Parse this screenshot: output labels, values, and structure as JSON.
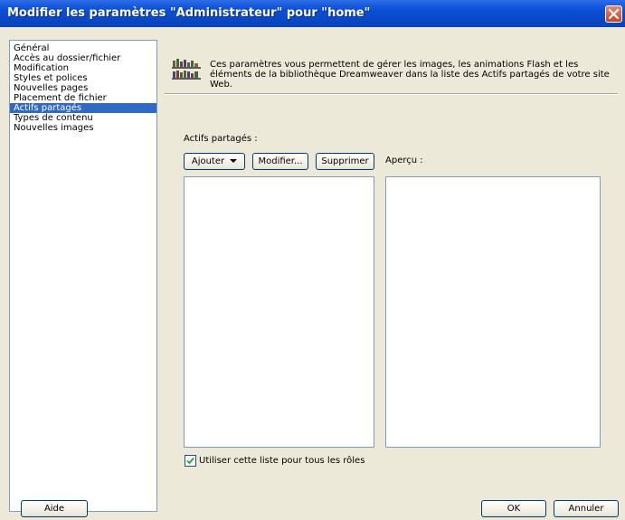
{
  "window": {
    "title": "Modifier les paramètres \"Administrateur\" pour \"home\""
  },
  "sidebar": {
    "items": [
      {
        "label": "Général",
        "selected": false
      },
      {
        "label": "Accès au dossier/fichier",
        "selected": false
      },
      {
        "label": "Modification",
        "selected": false
      },
      {
        "label": "Styles et polices",
        "selected": false
      },
      {
        "label": "Nouvelles pages",
        "selected": false
      },
      {
        "label": "Placement de fichier",
        "selected": false
      },
      {
        "label": "Actifs partagés",
        "selected": true
      },
      {
        "label": "Types de contenu",
        "selected": false
      },
      {
        "label": "Nouvelles images",
        "selected": false
      }
    ]
  },
  "main": {
    "description": "Ces paramètres vous permettent de gérer les images, les animations Flash et les éléments de la bibliothèque Dreamweaver dans la liste des Actifs partagés de votre site Web.",
    "assets_label": "Actifs partagés :",
    "preview_label": "Aperçu :",
    "add_button": "Ajouter",
    "modify_button": "Modifier...",
    "delete_button": "Supprimer",
    "use_for_all_roles": {
      "label": "Utiliser cette liste pour tous les rôles",
      "checked": true
    }
  },
  "footer": {
    "help_button": "Aide",
    "ok_button": "OK",
    "cancel_button": "Annuler"
  },
  "icons": {
    "library": "library-books-icon",
    "close": "close-icon",
    "dropdown": "caret-down-icon",
    "check": "checkmark-icon"
  },
  "colors": {
    "titlebar": "#0a50d8",
    "selection": "#316ac5",
    "dialog_bg": "#ece9d8",
    "close_button": "#c6452c"
  }
}
